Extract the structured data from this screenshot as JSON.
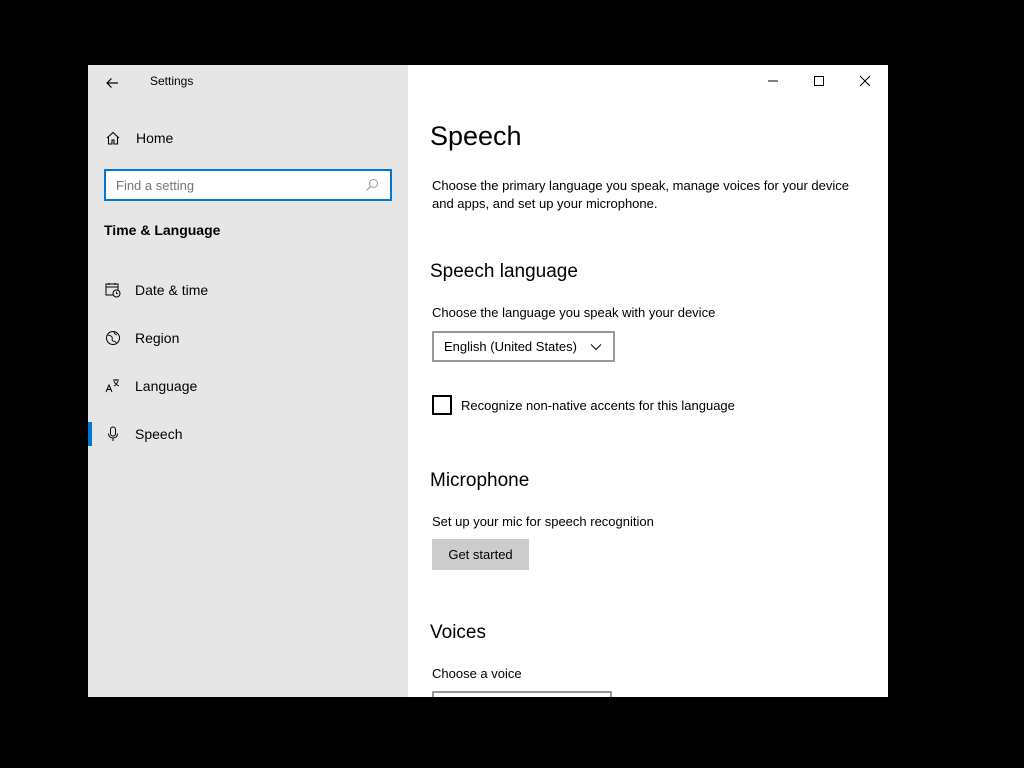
{
  "window": {
    "app_title": "Settings",
    "controls": [
      "minimize",
      "maximize",
      "close"
    ]
  },
  "nav": {
    "home_label": "Home",
    "search_placeholder": "Find a setting",
    "section_title": "Time & Language",
    "items": [
      {
        "label": "Date & time",
        "icon": "calendar-clock-icon",
        "selected": false
      },
      {
        "label": "Region",
        "icon": "globe-icon",
        "selected": false
      },
      {
        "label": "Language",
        "icon": "language-icon",
        "selected": false
      },
      {
        "label": "Speech",
        "icon": "microphone-icon",
        "selected": true
      }
    ]
  },
  "content": {
    "title": "Speech",
    "description": "Choose the primary language you speak, manage voices for your device and apps, and set up your microphone.",
    "speech_language": {
      "heading": "Speech language",
      "label": "Choose the language you speak with your device",
      "selected": "English (United States)",
      "checkbox_label": "Recognize non-native accents for this language",
      "checkbox_checked": false
    },
    "microphone": {
      "heading": "Microphone",
      "label": "Set up your mic for speech recognition",
      "button": "Get started"
    },
    "voices": {
      "heading": "Voices",
      "label": "Choose a voice"
    }
  },
  "colors": {
    "accent": "#0078d7",
    "nav_bg": "#e6e6e6",
    "button_bg": "#cccccc"
  }
}
